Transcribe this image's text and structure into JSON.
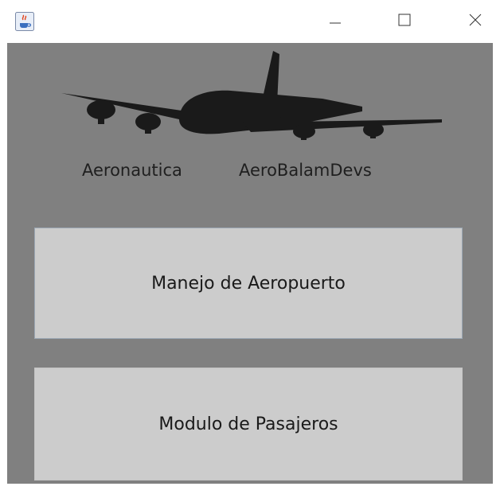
{
  "window": {
    "app_icon": "java-cup-icon",
    "controls": {
      "minimize": "minimize-icon",
      "maximize": "maximize-icon",
      "close": "close-icon"
    }
  },
  "header": {
    "logo_icon": "airplane-icon",
    "label_left": "Aeronautica",
    "label_right": "AeroBalamDevs"
  },
  "buttons": {
    "airport_management": "Manejo de Aeropuerto",
    "passenger_module": "Modulo de Pasajeros"
  },
  "colors": {
    "panel_background": "#808080",
    "button_background": "#cccccc",
    "plane_silhouette": "#1a1a1a"
  }
}
